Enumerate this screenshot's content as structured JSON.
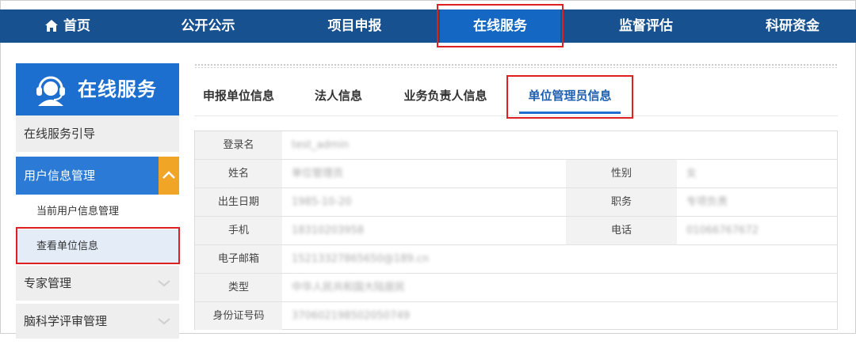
{
  "nav": {
    "items": [
      {
        "label": "首页",
        "icon": "home-icon"
      },
      {
        "label": "公开公示"
      },
      {
        "label": "项目申报"
      },
      {
        "label": "在线服务",
        "active": true
      },
      {
        "label": "监督评估"
      },
      {
        "label": "科研资金"
      }
    ]
  },
  "sidebar": {
    "title": "在线服务",
    "items": [
      {
        "label": "在线服务引导"
      },
      {
        "label": "用户信息管理",
        "expanded": true
      },
      {
        "label": "当前用户信息管理"
      },
      {
        "label": "查看单位信息",
        "selected": true
      },
      {
        "label": "专家管理"
      },
      {
        "label": "脑科学评审管理"
      }
    ]
  },
  "tabs": [
    {
      "label": "申报单位信息"
    },
    {
      "label": "法人信息"
    },
    {
      "label": "业务负责人信息"
    },
    {
      "label": "单位管理员信息",
      "active": true
    }
  ],
  "info": {
    "login_label": "登录名",
    "login_value": "test_admin",
    "name_label": "姓名",
    "name_value": "单位管理员",
    "gender_label": "性别",
    "gender_value": "女",
    "birth_label": "出生日期",
    "birth_value": "1985-10-20",
    "position_label": "职务",
    "position_value": "专项负责",
    "mobile_label": "手机",
    "mobile_value": "18310203958",
    "phone_label": "电话",
    "phone_value": "01066767672",
    "email_label": "电子邮箱",
    "email_value": "15213327865650@189.cn",
    "type_label": "类型",
    "type_value": "中华人民共和国大陆居民",
    "id_label": "身份证号码",
    "id_value": "370602198502050749"
  },
  "colors": {
    "nav_bg": "#18518f",
    "nav_active": "#1468c3",
    "highlight": "#e02020",
    "accent": "#f0a526"
  }
}
